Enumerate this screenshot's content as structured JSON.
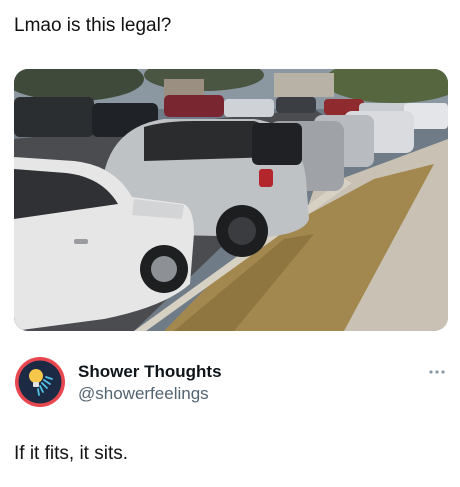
{
  "post": {
    "caption": "Lmao is this legal?",
    "photo_alt": "",
    "quoted": {
      "display_name": "Shower Thoughts",
      "handle": "@showerfeelings",
      "text": "If it fits, it sits."
    },
    "more_icon": "more-horizontal-icon",
    "avatar_icon": "lightbulb-shower-icon"
  },
  "colors": {
    "avatar_bg": "#1d2a44",
    "avatar_ring": "#e8474f",
    "handle": "#536471",
    "text": "#0f1419"
  }
}
